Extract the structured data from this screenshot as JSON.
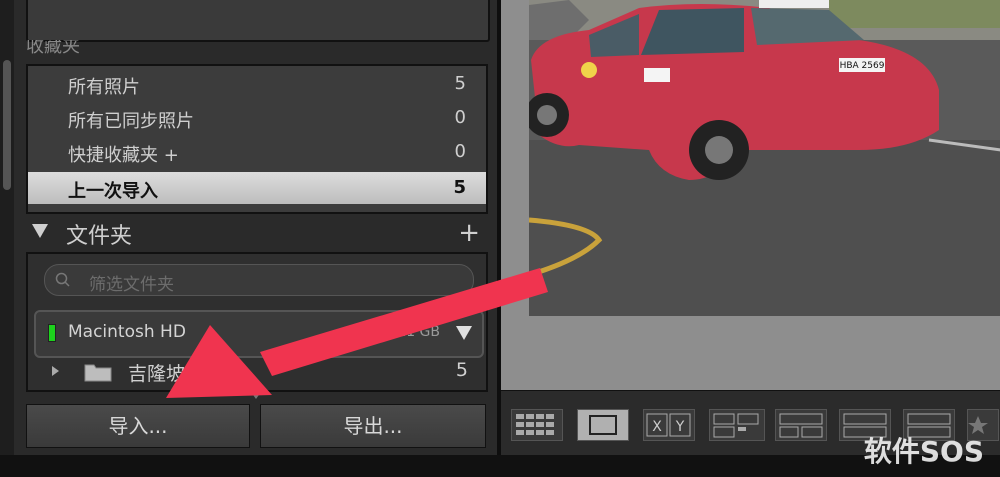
{
  "collections": {
    "header_partial": "收藏夹",
    "items": [
      {
        "label": "所有照片",
        "count": "5"
      },
      {
        "label": "所有已同步照片",
        "count": "0"
      },
      {
        "label": "快捷收藏夹 +",
        "count": "0"
      },
      {
        "label": "上一次导入",
        "count": "5"
      }
    ]
  },
  "folders": {
    "title": "文件夹",
    "add_label": "+",
    "filter_placeholder": "筛选文件夹",
    "volume": {
      "name": "Macintosh HD",
      "size": "121 GB"
    },
    "rows": [
      {
        "name": "吉隆坡",
        "count": "5"
      }
    ]
  },
  "buttons": {
    "import_label": "导入...",
    "export_label": "导出..."
  },
  "toolbar": {
    "compare_label_x": "X",
    "compare_label_y": "Y"
  },
  "photo": {
    "plate": "HBA 2569"
  },
  "watermark": "软件SOS",
  "colors": {
    "arrow": "#f0344f",
    "selected_row": "#d0d0d0"
  }
}
